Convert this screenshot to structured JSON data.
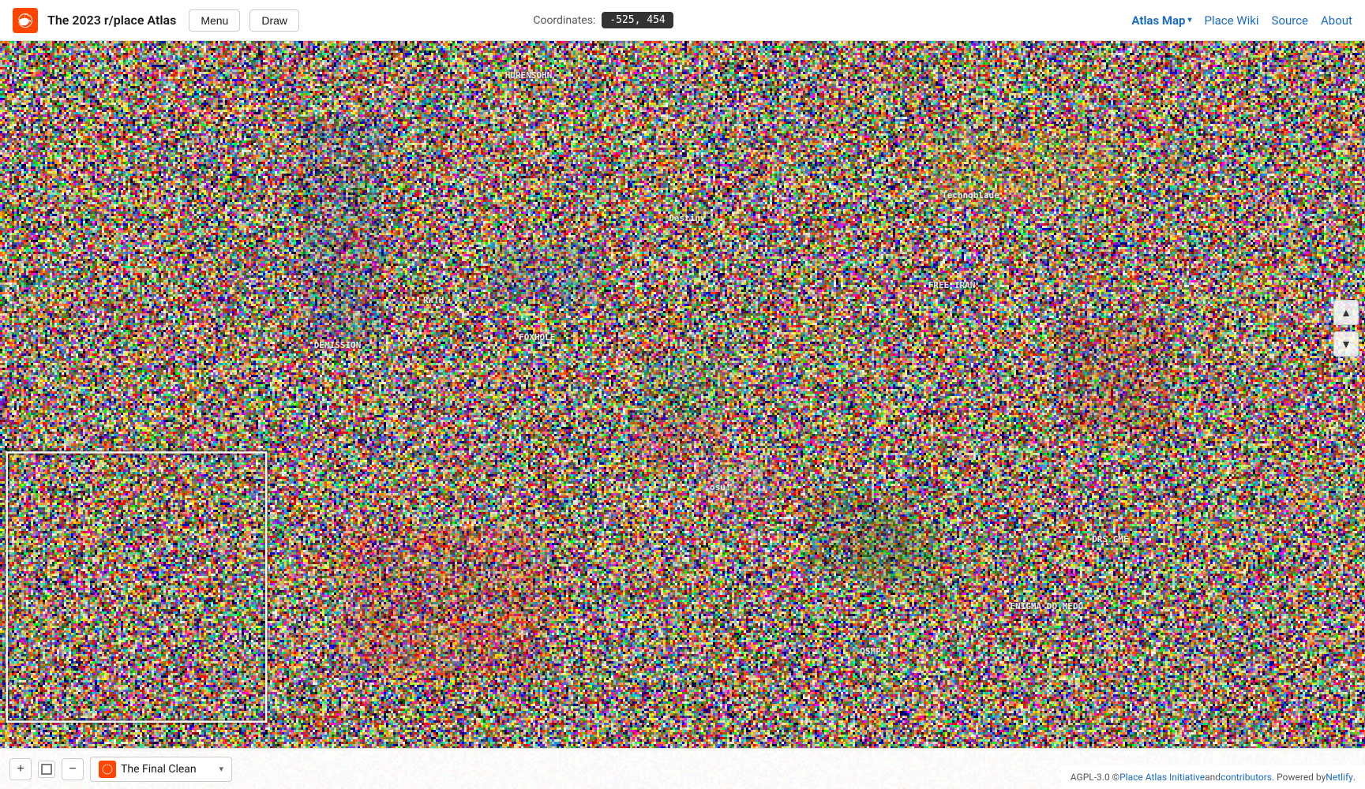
{
  "navbar": {
    "logo_alt": "r/place logo",
    "site_title": "The 2023 r/place Atlas",
    "menu_label": "Menu",
    "draw_label": "Draw",
    "coords_label": "Coordinates:",
    "coords_value": "-525, 454",
    "nav_atlas_map": "Atlas Map",
    "nav_place_wiki": "Place Wiki",
    "nav_source": "Source",
    "nav_about": "About"
  },
  "bottom_bar": {
    "zoom_in_label": "+",
    "zoom_out_label": "−",
    "square_icon": "□",
    "flag_icon": "⚑",
    "entry_name": "The Final Clean",
    "chevron": "▾"
  },
  "footer": {
    "text_pre": "AGPL-3.0 © ",
    "link_atlas": "Place Atlas Initiative",
    "text_mid": " and ",
    "link_contrib": "contributors",
    "text_post": ". Powered by ",
    "link_netlify": "Netlify",
    "text_end": "."
  },
  "side_arrows": {
    "up": "▲",
    "down": "▼"
  }
}
